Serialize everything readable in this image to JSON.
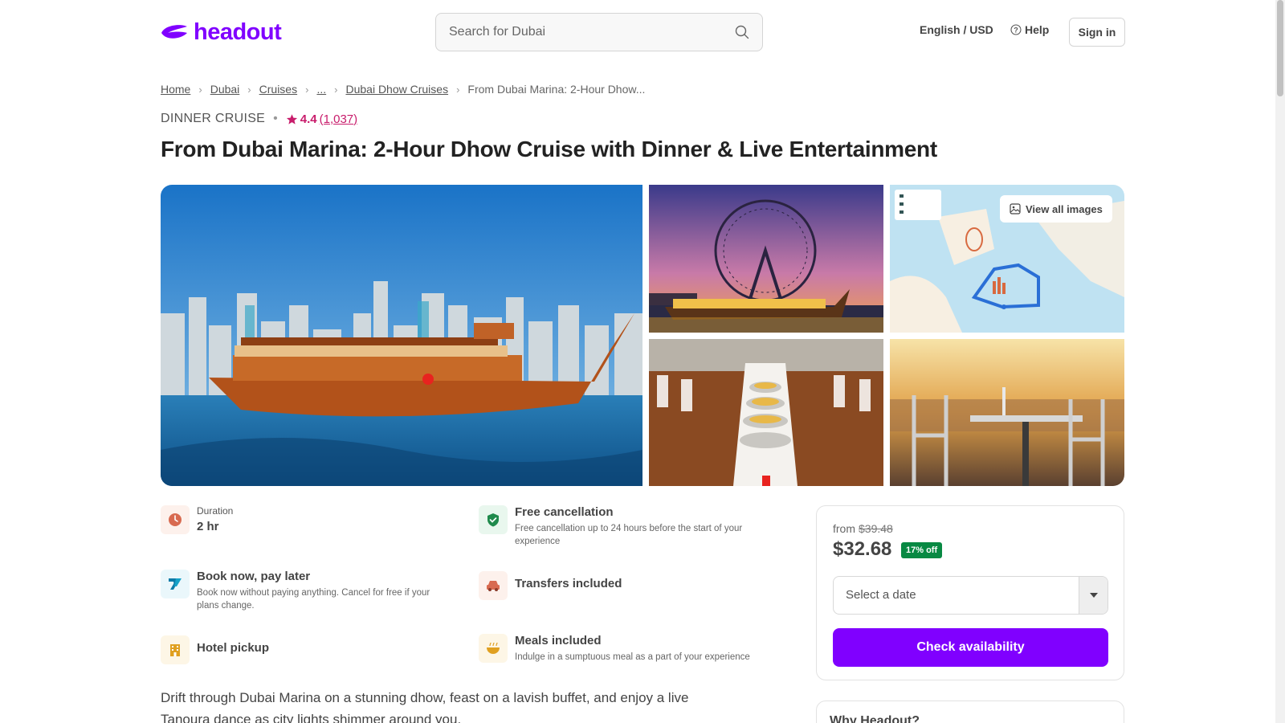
{
  "header": {
    "brand": "headout",
    "search_placeholder": "Search for Dubai",
    "language_currency": "English / USD",
    "help": "Help",
    "sign_in": "Sign in"
  },
  "breadcrumb": {
    "items": [
      "Home",
      "Dubai",
      "Cruises",
      "...",
      "Dubai Dhow Cruises"
    ],
    "current": "From Dubai Marina: 2-Hour Dhow..."
  },
  "product": {
    "category": "DINNER CRUISE",
    "rating": "4.4",
    "rating_count": "(1,037)",
    "title": "From Dubai Marina: 2-Hour Dhow Cruise with Dinner & Live Entertainment",
    "view_all_images": "View all images",
    "description": "Drift through Dubai Marina on a stunning dhow, feast on a lavish buffet, and enjoy a live Tanoura dance as city lights shimmer around you."
  },
  "features": {
    "duration_label": "Duration",
    "duration_value": "2 hr",
    "free_cancellation_title": "Free cancellation",
    "free_cancellation_desc": "Free cancellation up to 24 hours before the start of your experience",
    "book_now_title": "Book now, pay later",
    "book_now_desc": "Book now without paying anything. Cancel for free if your plans change.",
    "transfers_title": "Transfers included",
    "hotel_pickup_title": "Hotel pickup",
    "meals_title": "Meals included",
    "meals_desc": "Indulge in a sumptuous meal as a part of your experience"
  },
  "booking": {
    "from_label": "from",
    "original_price": "$39.48",
    "price": "$32.68",
    "discount": "17% off",
    "date_placeholder": "Select a date",
    "cta": "Check availability"
  },
  "why": {
    "title": "Why Headout?"
  },
  "colors": {
    "brand": "#8000ff",
    "rating": "#c81c6b",
    "discount": "#088943"
  }
}
